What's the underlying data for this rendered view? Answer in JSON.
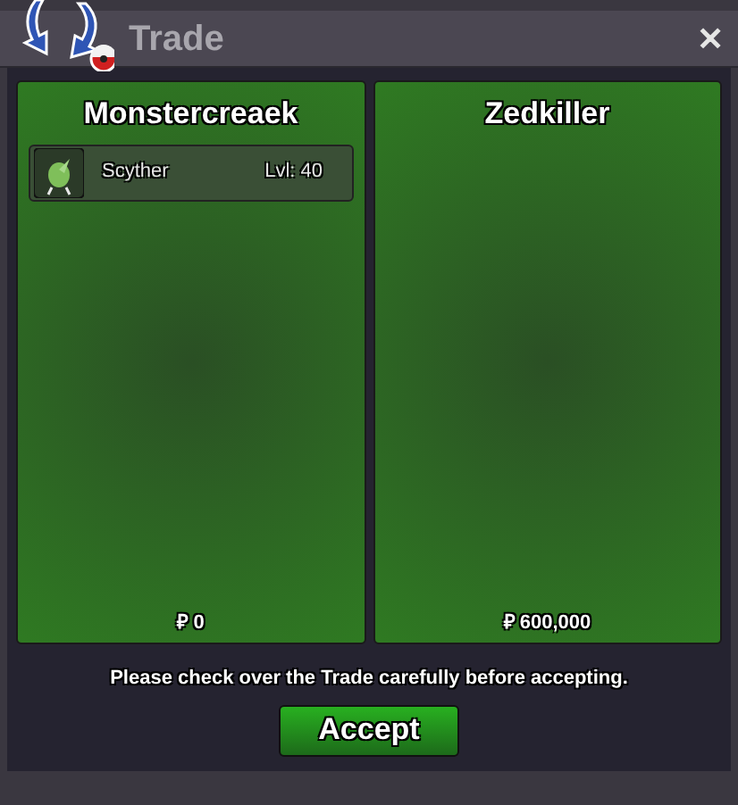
{
  "window": {
    "title": "Trade",
    "close": "✕"
  },
  "panels": [
    {
      "player": "Monstercreaek",
      "items": [
        {
          "name": "Scyther",
          "level": "Lvl: 40"
        }
      ],
      "money": "₽ 0"
    },
    {
      "player": "Zedkiller",
      "money": "₽ 600,000"
    }
  ],
  "notice": "Please check over the Trade carefully before accepting.",
  "accept_button": "Accept"
}
